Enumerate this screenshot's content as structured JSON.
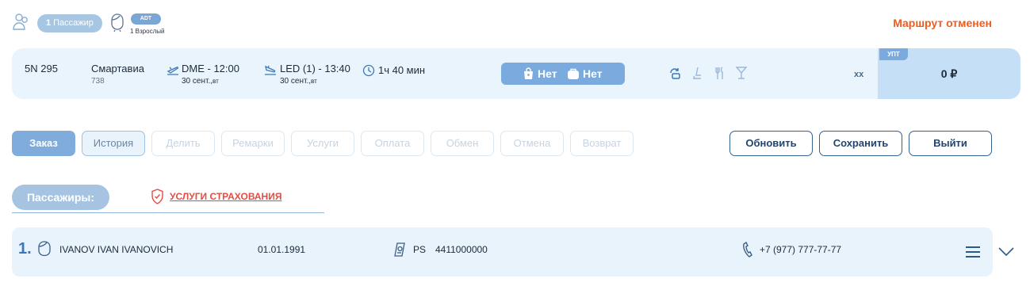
{
  "header": {
    "passengers_count": "1",
    "passengers_label": "Пассажир",
    "pax_type": "ADT",
    "pax_type_sub": "1 Взрослый",
    "status": "Маршрут отменен",
    "status_color": "#f25b1e"
  },
  "flight": {
    "flight_number": "5N 295",
    "airline": "Смартавиа",
    "aircraft": "738",
    "departure": "DME - 12:00",
    "departure_date": "30 сент.,",
    "departure_weekday": "вт",
    "arrival": "LED (1) - 13:40",
    "arrival_date": "30 сент.,",
    "arrival_weekday": "вт",
    "duration": "1ч 40 мин",
    "baggage": "Нет",
    "hand_luggage": "Нет",
    "fare_code": "xx",
    "price_tag": "УПТ",
    "price": "0 ₽",
    "icons": [
      "takeoff-icon",
      "landing-icon",
      "clock-icon",
      "bag-icon",
      "luggage-icon",
      "refund-icon",
      "seat-icon",
      "meal-icon",
      "drink-icon"
    ]
  },
  "tabs": [
    {
      "label": "Заказ",
      "state": "active"
    },
    {
      "label": "История",
      "state": "enabled"
    },
    {
      "label": "Делить",
      "state": "disabled"
    },
    {
      "label": "Ремарки",
      "state": "disabled"
    },
    {
      "label": "Услуги",
      "state": "disabled"
    },
    {
      "label": "Оплата",
      "state": "disabled"
    },
    {
      "label": "Обмен",
      "state": "disabled"
    },
    {
      "label": "Отмена",
      "state": "disabled"
    },
    {
      "label": "Возврат",
      "state": "disabled"
    }
  ],
  "actions": {
    "refresh": "Обновить",
    "save": "Сохранить",
    "exit": "Выйти"
  },
  "passengers_section": {
    "title": "Пассажиры:",
    "insurance_link": "УСЛУГИ СТРАХОВАНИЯ"
  },
  "passengers": [
    {
      "index": "1.",
      "name": "IVANOV IVAN IVANOVICH",
      "birth_date": "01.01.1991",
      "doc_type": "PS",
      "doc_number": "4411000000",
      "phone": "+7 (977) 777-77-77"
    }
  ],
  "colors": {
    "accent": "#80acdc",
    "card_bg": "#eaf4fd",
    "price_bg": "#c5dff6",
    "link_red": "#e24d44",
    "button_border": "#34618f"
  }
}
